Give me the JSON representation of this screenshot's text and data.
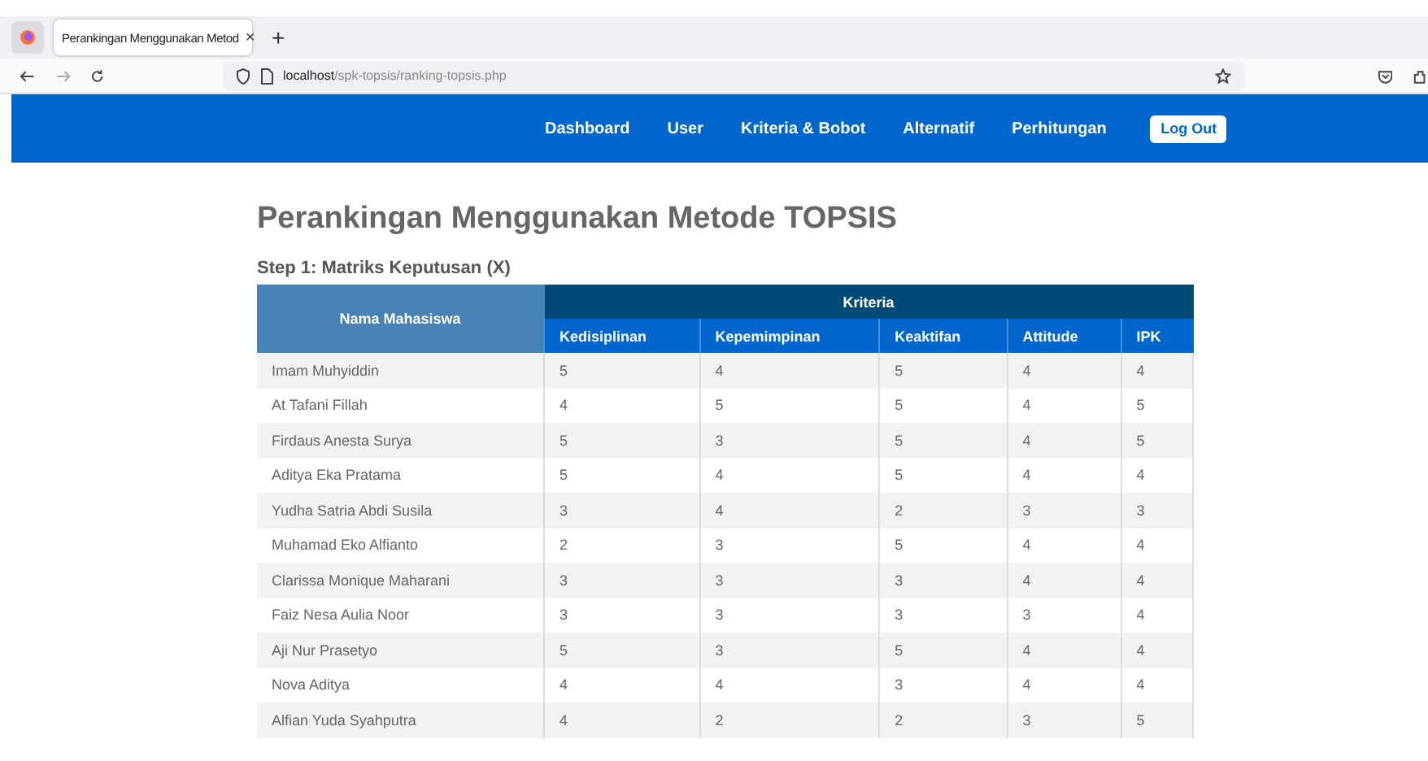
{
  "browser": {
    "tab_title": "Perankingan Menggunakan Metod",
    "tab_close": "×",
    "new_tab": "+",
    "url_host": "localhost",
    "url_path": "/spk-topsis/ranking-topsis.php"
  },
  "nav": {
    "items": [
      "Dashboard",
      "User",
      "Kriteria & Bobot",
      "Alternatif",
      "Perhitungan"
    ],
    "logout": "Log Out"
  },
  "page_title": "Perankingan Menggunakan Metode TOPSIS",
  "step_title": "Step 1: Matriks Keputusan (X)",
  "table": {
    "name_header": "Nama Mahasiswa",
    "group_header": "Kriteria",
    "columns": [
      "Kedisiplinan",
      "Kepemimpinan",
      "Keaktifan",
      "Attitude",
      "IPK"
    ],
    "rows": [
      {
        "name": "Imam Muhyiddin",
        "values": [
          "5",
          "4",
          "5",
          "4",
          "4"
        ]
      },
      {
        "name": "At Tafani Fillah",
        "values": [
          "4",
          "5",
          "5",
          "4",
          "5"
        ]
      },
      {
        "name": "Firdaus Anesta Surya",
        "values": [
          "5",
          "3",
          "5",
          "4",
          "5"
        ]
      },
      {
        "name": "Aditya Eka Pratama",
        "values": [
          "5",
          "4",
          "5",
          "4",
          "4"
        ]
      },
      {
        "name": "Yudha Satria Abdi Susila",
        "values": [
          "3",
          "4",
          "2",
          "3",
          "3"
        ]
      },
      {
        "name": "Muhamad Eko Alfianto",
        "values": [
          "2",
          "3",
          "5",
          "4",
          "4"
        ]
      },
      {
        "name": "Clarissa Monique Maharani",
        "values": [
          "3",
          "3",
          "3",
          "4",
          "4"
        ]
      },
      {
        "name": "Faiz Nesa Aulia Noor",
        "values": [
          "3",
          "3",
          "3",
          "3",
          "4"
        ]
      },
      {
        "name": "Aji Nur Prasetyo",
        "values": [
          "5",
          "3",
          "5",
          "4",
          "4"
        ]
      },
      {
        "name": "Nova Aditya",
        "values": [
          "4",
          "4",
          "3",
          "4",
          "4"
        ]
      },
      {
        "name": "Alfian Yuda Syahputra",
        "values": [
          "4",
          "2",
          "2",
          "3",
          "5"
        ]
      }
    ]
  }
}
